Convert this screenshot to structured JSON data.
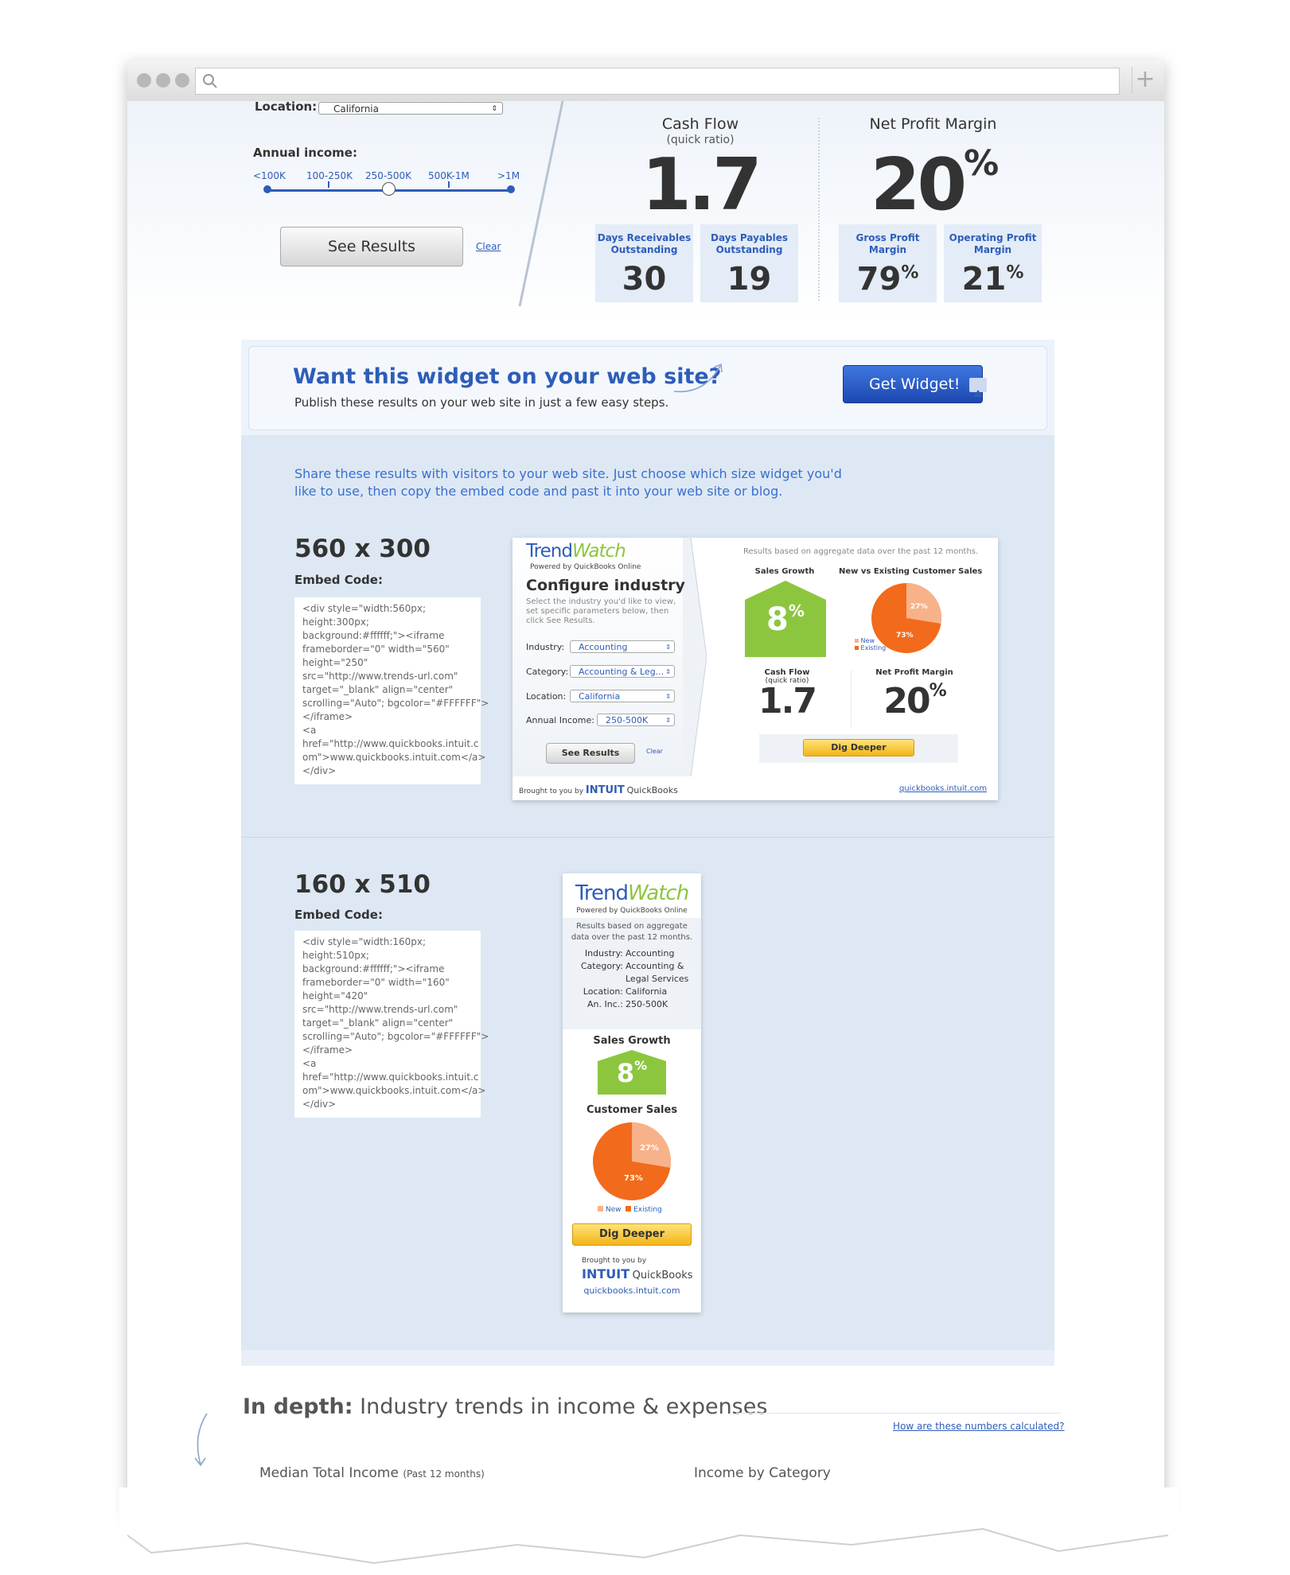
{
  "filters": {
    "location_label": "Location:",
    "location_value": "California",
    "income_label": "Annual income:",
    "income_options": [
      "<100K",
      "100-250K",
      "250-500K",
      "500K-1M",
      ">1M"
    ],
    "income_selected": "250-500K",
    "see_results": "See Results",
    "clear": "Clear"
  },
  "cash_flow": {
    "title": "Cash Flow",
    "subtitle": "(quick ratio)",
    "value": "1.7",
    "days_receivables_label": "Days Receivables Outstanding",
    "days_receivables_value": "30",
    "days_payables_label": "Days Payables Outstanding",
    "days_payables_value": "19"
  },
  "net_profit": {
    "title": "Net Profit Margin",
    "value": "20",
    "gross_label": "Gross Profit Margin",
    "gross_value": "79",
    "operating_label": "Operating Profit Margin",
    "operating_value": "21",
    "percent": "%"
  },
  "banner": {
    "headline": "Want this widget on your web site?",
    "sub": "Publish these results on your web site in just a few easy steps.",
    "button": "Get Widget!"
  },
  "share_text": "Share these results with visitors to your web site. Just choose which size widget you'd like to use, then copy the embed code and past it into your web site or blog.",
  "embed_large": {
    "size": "560 x 300",
    "label": "Embed Code:",
    "code": "<div style=\"width:560px;\nheight:300px;\nbackground:#ffffff;\"><iframe\nframeborder=\"0\" width=\"560\"\nheight=\"250\"\nsrc=\"http://www.trends-url.com\"\ntarget=\"_blank\" align=\"center\"\nscrolling=\"Auto\"; bgcolor=\"#FFFFFF\">\n</iframe>\n<a\nhref=\"http://www.quickbooks.intuit.c\nom\">www.quickbooks.intuit.com</a>\n</div>"
  },
  "embed_small": {
    "size": "160 x 510",
    "label": "Embed Code:",
    "code": "<div style=\"width:160px;\nheight:510px;\nbackground:#ffffff;\"><iframe\nframeborder=\"0\" width=\"160\"\nheight=\"420\"\nsrc=\"http://www.trends-url.com\"\ntarget=\"_blank\" align=\"center\"\nscrolling=\"Auto\"; bgcolor=\"#FFFFFF\">\n</iframe>\n<a\nhref=\"http://www.quickbooks.intuit.c\nom\">www.quickbooks.intuit.com</a>\n</div>"
  },
  "widget_large": {
    "brand_trend": "Trend",
    "brand_watch": "Watch",
    "powered": "Powered by QuickBooks Online",
    "configure": "Configure industry",
    "instructions": "Select the industry you'd like to view, set specific parameters below, then click See Results.",
    "industry_label": "Industry:",
    "industry_value": "Accounting",
    "category_label": "Category:",
    "category_value": "Accounting & Leg...",
    "location_label": "Location:",
    "location_value": "California",
    "income_label": "Annual Income:",
    "income_value": "250-500K",
    "see_results": "See Results",
    "clear": "Clear",
    "results_note": "Results based on aggregate data over the past 12 months.",
    "sales_growth_label": "Sales Growth",
    "sales_growth_value": "8",
    "customer_sales_label": "New vs Existing Customer Sales",
    "new_pct": "27%",
    "existing_pct": "73%",
    "legend_new": "New",
    "legend_existing": "Existing",
    "cash_flow_label": "Cash Flow",
    "cash_flow_sub": "(quick ratio)",
    "cash_flow_value": "1.7",
    "net_profit_label": "Net Profit Margin",
    "net_profit_value": "20",
    "dig_deeper": "Dig Deeper",
    "brought": "Brought to you by",
    "intuit": "INTUIT",
    "quickbooks": "QuickBooks",
    "site": "quickbooks.intuit.com"
  },
  "widget_small": {
    "brand_trend": "Trend",
    "brand_watch": "Watch",
    "powered": "Powered by QuickBooks Online",
    "note": "Results based on aggregate data over the past 12 months.",
    "industry_label": "Industry:",
    "industry_value": "Accounting",
    "category_label": "Category:",
    "category_value": "Accounting & Legal Services",
    "location_label": "Location:",
    "location_value": "California",
    "income_label": "An. Inc.:",
    "income_value": "250-500K",
    "sales_growth_label": "Sales Growth",
    "sales_growth_value": "8",
    "customer_sales_label": "Customer Sales",
    "new_pct": "27%",
    "existing_pct": "73%",
    "legend_new": "New",
    "legend_existing": "Existing",
    "dig_deeper": "Dig Deeper",
    "brought": "Brought to you by",
    "intuit": "INTUIT",
    "quickbooks": "QuickBooks",
    "site": "quickbooks.intuit.com"
  },
  "in_depth": {
    "bold": "In depth:",
    "rest": "Industry trends in income & expenses",
    "how_link": "How are these numbers calculated?",
    "median_label": "Median Total Income",
    "median_sub": "(Past 12 months)",
    "income_by_category": "Income by Category"
  },
  "colors": {
    "accent_blue": "#2e5db8",
    "green": "#8cc63f",
    "orange": "#f26a1b",
    "light_orange": "#f7b28a",
    "yellow": "#f3b518"
  }
}
